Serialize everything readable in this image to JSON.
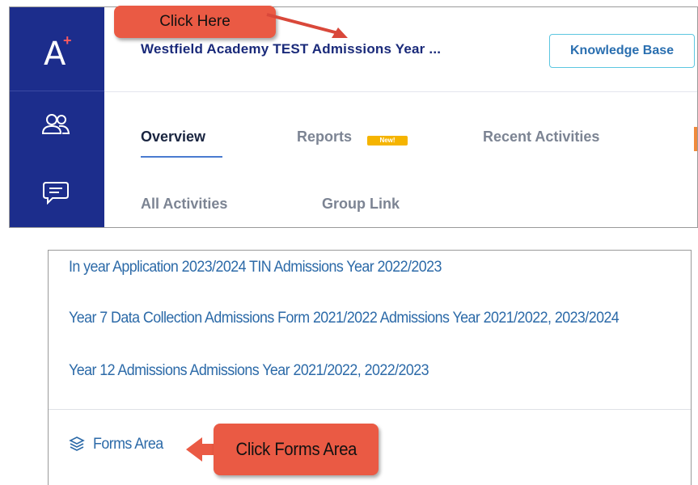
{
  "app": {
    "logo_letter": "A",
    "logo_plus": "+",
    "title": "Westfield Academy TEST Admissions Year ...",
    "knowledge_base_label": "Knowledge Base"
  },
  "sidebar": {
    "icons": [
      "users-icon",
      "chat-icon"
    ]
  },
  "tabs": {
    "overview": "Overview",
    "reports": "Reports",
    "reports_badge": "New!",
    "recent_activities": "Recent Activities",
    "all_activities": "All Activities",
    "group_link": "Group Link"
  },
  "forms_list": {
    "items": [
      "In year Application 2023/2024 TIN Admissions Year 2022/2023",
      "Year 7 Data Collection Admissions Form 2021/2022 Admissions Year 2021/2022, 2023/2024",
      "Year 12 Admissions Admissions Year 2021/2022, 2022/2023"
    ],
    "forms_area_label": "Forms Area"
  },
  "annotations": {
    "click_here": "Click Here",
    "click_forms_area": "Click Forms Area"
  },
  "colors": {
    "sidebar": "#1c2d8c",
    "accent_red": "#ff5a5f",
    "callout": "#ea5a44",
    "link": "#2c6aa8",
    "badge": "#f5b400"
  }
}
